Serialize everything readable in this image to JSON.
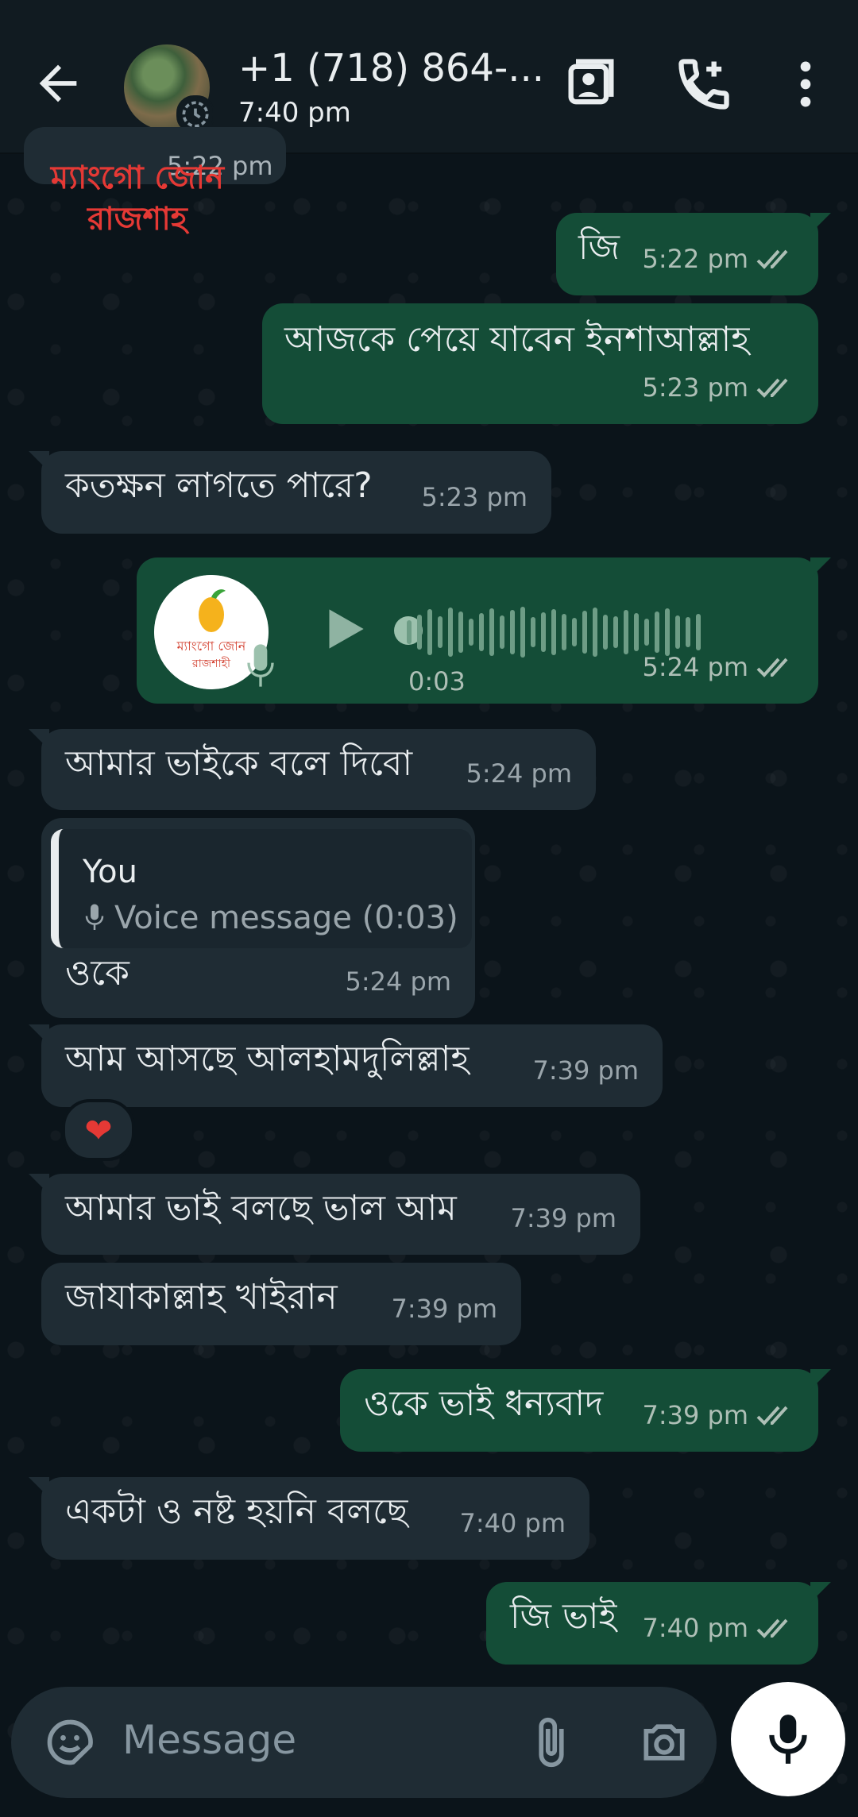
{
  "header": {
    "contact_name": "+1 (718) 864-...",
    "last_seen": "7:40 pm"
  },
  "overlay": {
    "red_text_line1": "ম্যাংগো জোন",
    "red_text_line2": "রাজশাহ",
    "partial_time": "5:22 pm"
  },
  "messages": [
    {
      "dir": "out",
      "text": "জি",
      "time": "5:22 pm"
    },
    {
      "dir": "out",
      "text": "আজকে পেয়ে যাবেন ইনশাআল্লাহ",
      "time": "5:23 pm"
    },
    {
      "dir": "in",
      "text": "কতক্ষন লাগতে পারে?",
      "time": "5:23 pm"
    },
    {
      "dir": "out",
      "type": "voice",
      "duration": "0:03",
      "time": "5:24 pm",
      "avatar_text": "ম্যাংগো জোন রাজশাহী"
    },
    {
      "dir": "in",
      "text": "আমার ভাইকে বলে দিবো",
      "time": "5:24 pm"
    },
    {
      "dir": "in",
      "quote_author": "You",
      "quote_text": "Voice message (0:03)",
      "text": "ওকে",
      "time": "5:24 pm"
    },
    {
      "dir": "in",
      "text": "আম আসছে আলহামদুলিল্লাহ",
      "time": "7:39 pm",
      "reaction": "❤"
    },
    {
      "dir": "in",
      "text": "আমার ভাই বলছে ভাল আম",
      "time": "7:39 pm"
    },
    {
      "dir": "in",
      "text": "জাযাকাল্লাহ খাইরান",
      "time": "7:39 pm"
    },
    {
      "dir": "out",
      "text": "ওকে ভাই ধন্যবাদ",
      "time": "7:39 pm"
    },
    {
      "dir": "in",
      "text": "একটা ও নষ্ট হয়নি বলছে",
      "time": "7:40 pm"
    },
    {
      "dir": "out",
      "text": "জি ভাই",
      "time": "7:40 pm"
    }
  ],
  "composer": {
    "placeholder": "Message"
  },
  "icons": [
    "back-arrow-icon",
    "video-call-icon",
    "add-call-icon",
    "more-vert-icon",
    "sticker-icon",
    "attach-icon",
    "camera-icon",
    "mic-icon",
    "play-icon",
    "double-check-icon"
  ],
  "colors": {
    "header": "#111b21",
    "background": "#0b141a",
    "incoming": "#1f2c34",
    "outgoing": "#144d37",
    "read_ticks": "#aebfb6"
  }
}
